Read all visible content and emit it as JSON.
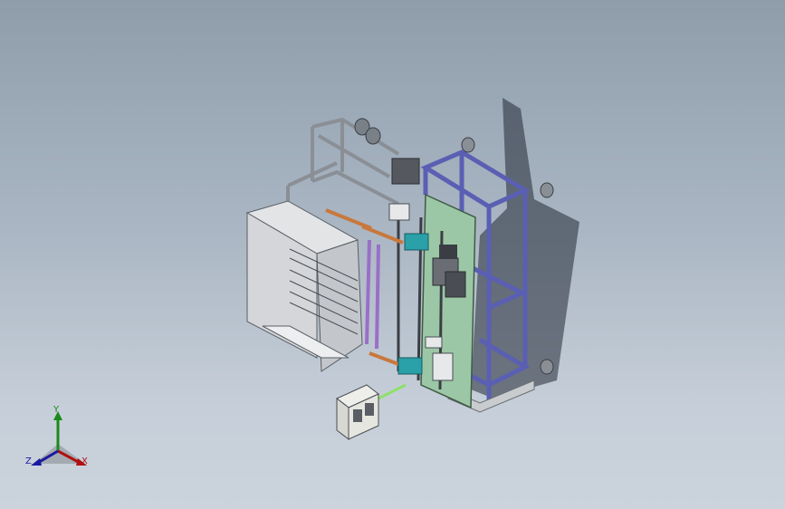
{
  "viewport": {
    "background_top": "#8f9dab",
    "background_bottom": "#cbd3dc"
  },
  "model": {
    "frame_color": "#5a5fb3",
    "panel_color": "#9cc7a6",
    "housing_color": "#d9d9d9",
    "accent_color": "#c8783c",
    "cyan_color": "#2aa0a8"
  },
  "triad": {
    "y_label": "Y",
    "z_label": "Z",
    "x_label": "X",
    "y_color": "#1a8a1a",
    "z_color": "#1a1aa0",
    "x_color": "#b01010"
  }
}
